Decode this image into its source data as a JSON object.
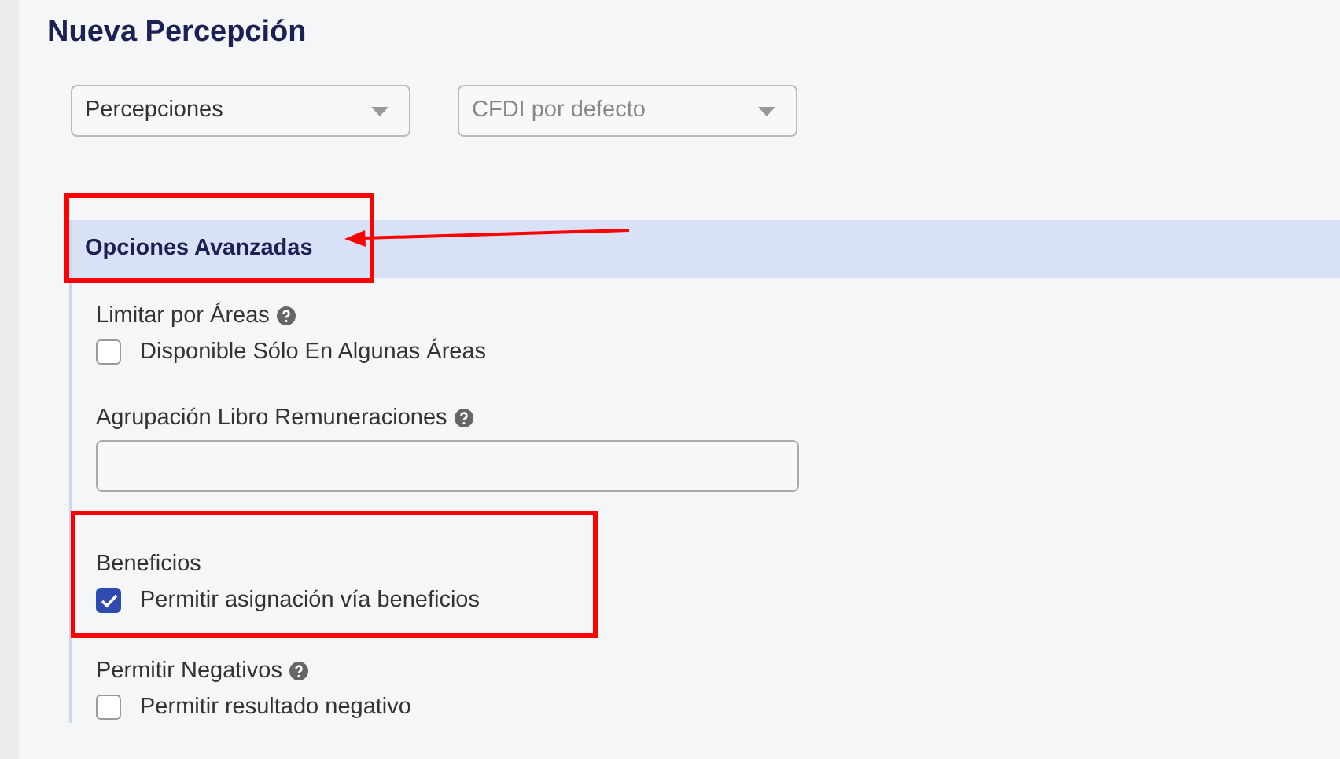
{
  "title": "Nueva Percepción",
  "selects": [
    {
      "value": "Percepciones"
    },
    {
      "placeholder": "CFDI por defecto"
    }
  ],
  "section": {
    "title": "Opciones Avanzadas",
    "highlighted": true,
    "arrow": true,
    "fields": [
      {
        "kind": "checkbox",
        "label": "Limitar por Áreas",
        "help": true,
        "option": "Disponible Sólo En Algunas Áreas",
        "checked": false,
        "highlighted": false
      },
      {
        "kind": "text",
        "label": "Agrupación Libro Remuneraciones",
        "help": true,
        "highlighted": false
      },
      {
        "kind": "checkbox",
        "label": "Beneficios",
        "help": false,
        "option": "Permitir asignación vía beneficios",
        "checked": true,
        "highlighted": true
      },
      {
        "kind": "checkbox",
        "label": "Permitir Negativos",
        "help": true,
        "option": "Permitir resultado negativo",
        "checked": false,
        "highlighted": false
      }
    ]
  }
}
